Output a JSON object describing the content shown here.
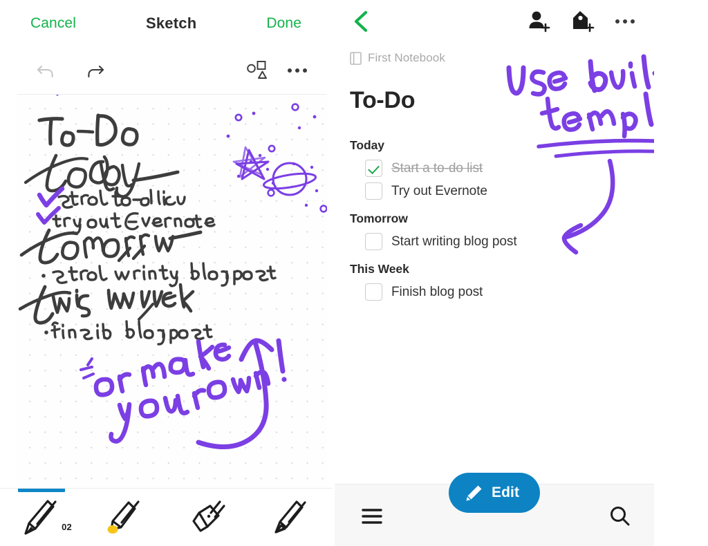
{
  "colors": {
    "evernote_green": "#12b34a",
    "accent_blue": "#0d83c4",
    "annotation_purple": "#7b3fe4",
    "ink_black": "#3a3a3a",
    "muted_gray": "#9e9e9e",
    "highlighter_yellow": "#f5c518"
  },
  "sketch_panel": {
    "navbar": {
      "cancel_label": "Cancel",
      "title": "Sketch",
      "done_label": "Done"
    },
    "toolbar": {
      "undo_icon": "undo-icon",
      "redo_icon": "redo-icon",
      "shapes_icon": "shapes-icon",
      "more_icon": "more-horizontal-icon"
    },
    "canvas": {
      "paper": "dot-grid",
      "handwriting": {
        "title_line1": "To-Do",
        "section_today": "today",
        "today_items": [
          "start to-do list",
          "try out Evernote"
        ],
        "section_tomorrow": "tomorrow",
        "tomorrow_items": [
          "start writing blogpost"
        ],
        "section_this_week": "this week",
        "this_week_items": [
          "finish blogpost"
        ]
      },
      "doodles": [
        "star",
        "ringed-planet",
        "scattered-dots"
      ],
      "annotation": {
        "text_line1": "or make",
        "text_line2": "your own!",
        "arrow": "curved-arrow-up"
      }
    },
    "pen_tools": [
      {
        "name": "pen-tool",
        "icon": "pen-icon",
        "size_label": "02",
        "selected": true
      },
      {
        "name": "highlighter-tool",
        "icon": "highlighter-icon",
        "size_label": "",
        "selected": false
      },
      {
        "name": "eraser-tool",
        "icon": "eraser-icon",
        "size_label": "",
        "selected": false
      },
      {
        "name": "marker-tool",
        "icon": "marker-icon",
        "size_label": "",
        "selected": false
      }
    ]
  },
  "note_panel": {
    "navbar": {
      "back_icon": "chevron-left-icon",
      "share_icon": "add-person-icon",
      "tag_icon": "add-tag-icon",
      "more_icon": "more-horizontal-icon"
    },
    "notebook": {
      "icon": "notebook-icon",
      "name": "First Notebook"
    },
    "title": "To-Do",
    "groups": [
      {
        "heading": "Today",
        "items": [
          {
            "label": "Start a to-do list",
            "checked": true
          },
          {
            "label": "Try out Evernote",
            "checked": false
          }
        ]
      },
      {
        "heading": "Tomorrow",
        "items": [
          {
            "label": "Start writing blog post",
            "checked": false
          }
        ]
      },
      {
        "heading": "This Week",
        "items": [
          {
            "label": "Finish blog post",
            "checked": false
          }
        ]
      }
    ],
    "annotation": {
      "text_line1": "Use built in",
      "text_line2": "templates",
      "underline": "double-underline",
      "arrow": "curved-arrow-down-left"
    },
    "bottombar": {
      "menu_icon": "hamburger-menu-icon",
      "search_icon": "search-icon",
      "edit_label": "Edit",
      "edit_icon": "pencil-icon"
    }
  }
}
